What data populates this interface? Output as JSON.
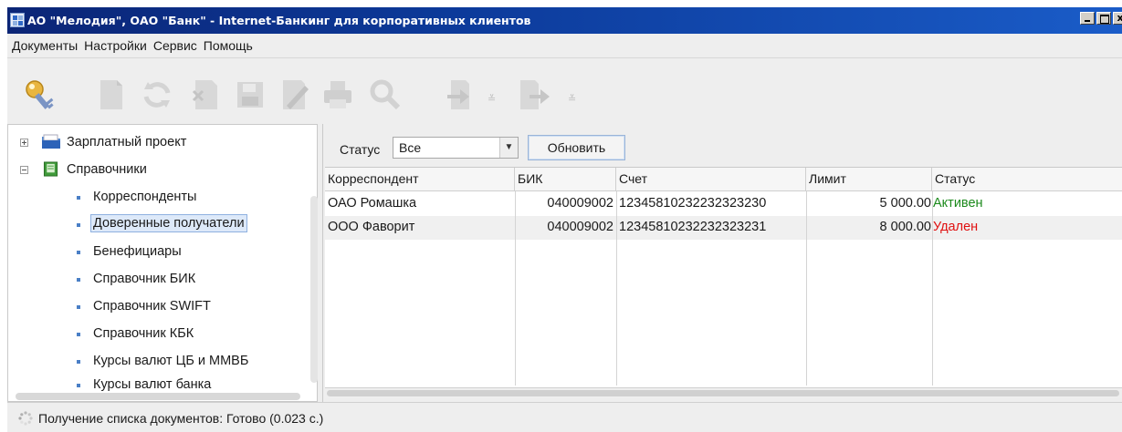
{
  "window": {
    "title": "АО \"Мелодия\", ОАО \"Банк\" - Internet-Банкинг для корпоративных клиентов",
    "buttons": {
      "minimize": "_",
      "maximize": "□",
      "close": "x"
    }
  },
  "menu": [
    "Документы",
    "Настройки",
    "Сервис",
    "Помощь"
  ],
  "toolbar": {
    "icons": [
      "key-icon",
      "document-icon",
      "refresh-icon",
      "delete-icon",
      "save-icon",
      "edit-icon",
      "print-icon",
      "search-icon",
      "export-icon",
      "import-icon"
    ]
  },
  "tree": {
    "nodes": [
      {
        "label": "Зарплатный проект",
        "expanded": false
      },
      {
        "label": "Справочники",
        "expanded": true
      }
    ],
    "children": [
      "Корреспонденты",
      "Доверенные получатели",
      "Бенефициары",
      "Справочник БИК",
      "Справочник SWIFT",
      "Справочник КБК",
      "Курсы валют ЦБ и ММВБ",
      "Курсы валют банка"
    ],
    "selected": "Доверенные получатели"
  },
  "filter": {
    "label": "Статус",
    "value": "Все",
    "refresh_label": "Обновить"
  },
  "table": {
    "columns": [
      "Корреспондент",
      "БИК",
      "Счет",
      "Лимит",
      "Статус"
    ],
    "rows": [
      {
        "correspondent": "ОАО Ромашка",
        "bik": "040009002",
        "account": "12345810232232323230",
        "limit": "5 000.00",
        "status": "Активен"
      },
      {
        "correspondent": "ООО Фаворит",
        "bik": "040009002",
        "account": "12345810232232323231",
        "limit": "8 000.00",
        "status": "Удален"
      }
    ]
  },
  "statusbar": {
    "text": "Получение списка документов: Готово (0.023 с.)"
  },
  "colors": {
    "title_gradient_start": "#0b2576",
    "title_gradient_end": "#1a5cc8",
    "status_active": "#1c8a1c",
    "status_deleted": "#e01010",
    "selection": "#dde9f9"
  }
}
